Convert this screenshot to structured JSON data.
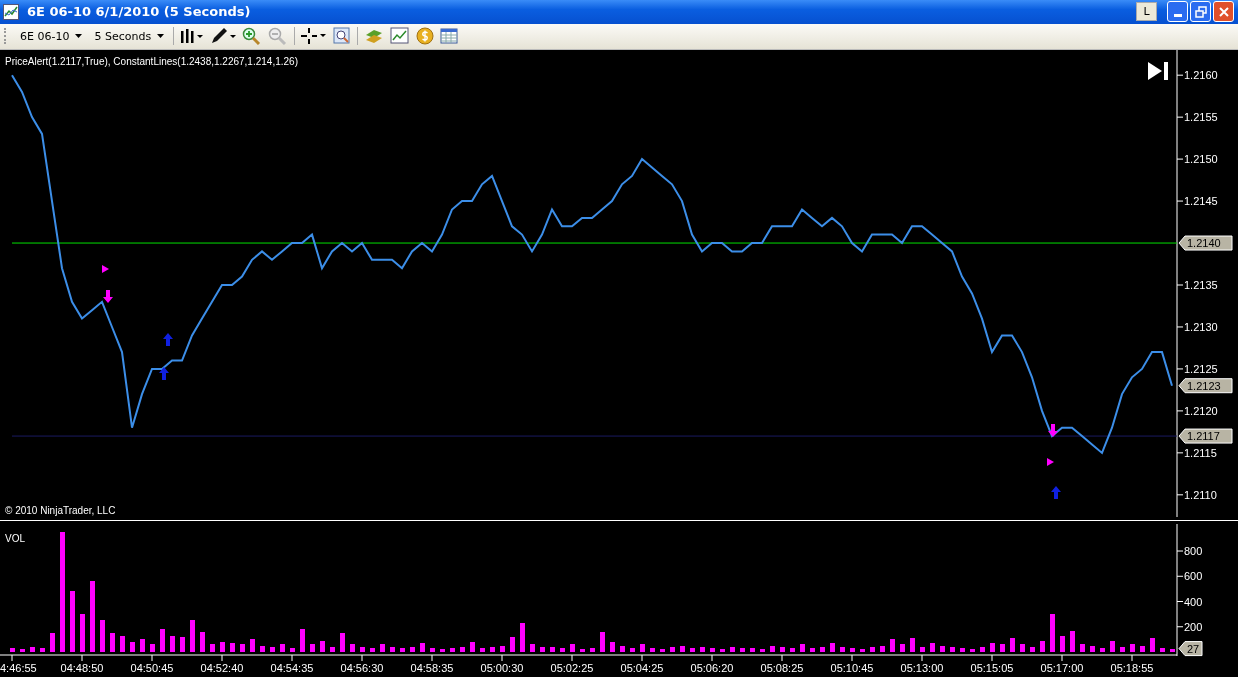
{
  "window": {
    "title": "6E 06-10  6/1/2010 (5 Seconds)",
    "layout_button": "L"
  },
  "toolbar": {
    "instrument": "6E 06-10",
    "interval": "5 Seconds"
  },
  "price_panel": {
    "copyright": "© 2010 NinjaTrader, LLC",
    "chart_data": {
      "type": "line",
      "title": "PriceAlert(1.2117,True), ConstantLines(1.2438,1.2267,1.214,1.26)",
      "ylim": [
        1.2107,
        1.2163
      ],
      "yticks": [
        {
          "value": 1.211,
          "label": "1.2110"
        },
        {
          "value": 1.2115,
          "label": "1.2115"
        },
        {
          "value": 1.212,
          "label": "1.2120"
        },
        {
          "value": 1.2125,
          "label": "1.2125"
        },
        {
          "value": 1.213,
          "label": "1.2130"
        },
        {
          "value": 1.2135,
          "label": "1.2135"
        },
        {
          "value": 1.2145,
          "label": "1.2145"
        },
        {
          "value": 1.215,
          "label": "1.2150"
        },
        {
          "value": 1.2155,
          "label": "1.2155"
        },
        {
          "value": 1.216,
          "label": "1.2160"
        }
      ],
      "categories": [
        null,
        null,
        null,
        null,
        null,
        null,
        null,
        null,
        null,
        null,
        null,
        null,
        null,
        null,
        null,
        null,
        null,
        null,
        null,
        null,
        null,
        null,
        null,
        null,
        null,
        null,
        null,
        null,
        null,
        null,
        null,
        null,
        null,
        null,
        null,
        null,
        null,
        null,
        null,
        null,
        null,
        null,
        null,
        null,
        null,
        null,
        null,
        null,
        null,
        null,
        null,
        null,
        null,
        null,
        null,
        null,
        null,
        null,
        null,
        null,
        null,
        null,
        null,
        null,
        null,
        null,
        null,
        null,
        null,
        null,
        null,
        null,
        null,
        null,
        null,
        null,
        null,
        null,
        null,
        null,
        null,
        null,
        null,
        null,
        null,
        null,
        null,
        null,
        null,
        null,
        null,
        null,
        null,
        null,
        null,
        null,
        null,
        null,
        null,
        null,
        null,
        null,
        null,
        null,
        null,
        null,
        null,
        null,
        null,
        null,
        null,
        null,
        null,
        null,
        null,
        null,
        null
      ],
      "series": [
        {
          "color": "#3c8ee8",
          "values": [
            1.216,
            1.2158,
            1.2155,
            1.2153,
            1.2145,
            1.2137,
            1.2133,
            1.2131,
            1.2132,
            1.2133,
            1.213,
            1.2127,
            1.2118,
            1.2122,
            1.2125,
            1.2125,
            1.2126,
            1.2126,
            1.2129,
            1.2131,
            1.2133,
            1.2135,
            1.2135,
            1.2136,
            1.2138,
            1.2139,
            1.2138,
            1.2139,
            1.214,
            1.214,
            1.2141,
            1.2137,
            1.2139,
            1.214,
            1.2139,
            1.214,
            1.2138,
            1.2138,
            1.2138,
            1.2137,
            1.2139,
            1.214,
            1.2139,
            1.2141,
            1.2144,
            1.2145,
            1.2145,
            1.2147,
            1.2148,
            1.2145,
            1.2142,
            1.2141,
            1.2139,
            1.2141,
            1.2144,
            1.2142,
            1.2142,
            1.2143,
            1.2143,
            1.2144,
            1.2145,
            1.2147,
            1.2148,
            1.215,
            1.2149,
            1.2148,
            1.2147,
            1.2145,
            1.2141,
            1.2139,
            1.214,
            1.214,
            1.2139,
            1.2139,
            1.214,
            1.214,
            1.2142,
            1.2142,
            1.2142,
            1.2144,
            1.2143,
            1.2142,
            1.2143,
            1.2142,
            1.214,
            1.2139,
            1.2141,
            1.2141,
            1.2141,
            1.214,
            1.2142,
            1.2142,
            1.2141,
            1.214,
            1.2139,
            1.2136,
            1.2134,
            1.2131,
            1.2127,
            1.2129,
            1.2129,
            1.2127,
            1.2124,
            1.212,
            1.2117,
            1.2118,
            1.2118,
            1.2117,
            1.2116,
            1.2115,
            1.2118,
            1.2122,
            1.2124,
            1.2125,
            1.2127,
            1.2127,
            1.2123
          ]
        }
      ],
      "ref_lines": [
        {
          "axis": "y",
          "value": 1.214,
          "label": "1.2140",
          "color": "#00e000"
        },
        {
          "axis": "y",
          "value": 1.2117,
          "label": "1.2117",
          "color": "#1a1a60"
        }
      ],
      "annotations": [
        "1.2123"
      ]
    }
  },
  "volume_panel": {
    "chart_data": {
      "type": "bar",
      "title": "VOL",
      "ylim": [
        0,
        1030
      ],
      "yticks": [
        200,
        400,
        600,
        800
      ],
      "categories": [
        "4:46:55",
        null,
        null,
        null,
        null,
        null,
        null,
        "04:48:50",
        null,
        null,
        null,
        null,
        null,
        null,
        "04:50:45",
        null,
        null,
        null,
        null,
        null,
        null,
        "04:52:40",
        null,
        null,
        null,
        null,
        null,
        null,
        "04:54:35",
        null,
        null,
        null,
        null,
        null,
        null,
        "04:56:30",
        null,
        null,
        null,
        null,
        null,
        null,
        "04:58:35",
        null,
        null,
        null,
        null,
        null,
        null,
        "05:00:30",
        null,
        null,
        null,
        null,
        null,
        null,
        "05:02:25",
        null,
        null,
        null,
        null,
        null,
        null,
        "05:04:25",
        null,
        null,
        null,
        null,
        null,
        null,
        "05:06:20",
        null,
        null,
        null,
        null,
        null,
        null,
        "05:08:25",
        null,
        null,
        null,
        null,
        null,
        null,
        "05:10:45",
        null,
        null,
        null,
        null,
        null,
        null,
        "05:13:00",
        null,
        null,
        null,
        null,
        null,
        null,
        "05:15:05",
        null,
        null,
        null,
        null,
        null,
        null,
        "05:17:00",
        null,
        null,
        null,
        null,
        null,
        null,
        "05:18:55",
        null,
        null,
        null,
        null
      ],
      "series": [
        {
          "color": "#ff00ff",
          "values": [
            30,
            20,
            40,
            30,
            150,
            950,
            480,
            300,
            560,
            250,
            150,
            130,
            80,
            100,
            60,
            180,
            130,
            120,
            250,
            160,
            60,
            80,
            70,
            60,
            100,
            50,
            40,
            60,
            30,
            180,
            60,
            90,
            40,
            150,
            60,
            40,
            30,
            60,
            40,
            30,
            40,
            70,
            30,
            20,
            30,
            40,
            80,
            30,
            40,
            50,
            120,
            230,
            60,
            40,
            40,
            30,
            60,
            20,
            30,
            160,
            80,
            50,
            30,
            60,
            30,
            20,
            40,
            50,
            30,
            40,
            30,
            20,
            40,
            30,
            30,
            20,
            50,
            40,
            30,
            60,
            30,
            40,
            70,
            40,
            30,
            20,
            40,
            50,
            100,
            60,
            110,
            40,
            70,
            50,
            40,
            30,
            20,
            40,
            70,
            60,
            110,
            60,
            40,
            90,
            300,
            130,
            170,
            60,
            50,
            30,
            90,
            40,
            60,
            50,
            110,
            30,
            27
          ]
        }
      ],
      "annotations": [
        "27"
      ]
    }
  }
}
